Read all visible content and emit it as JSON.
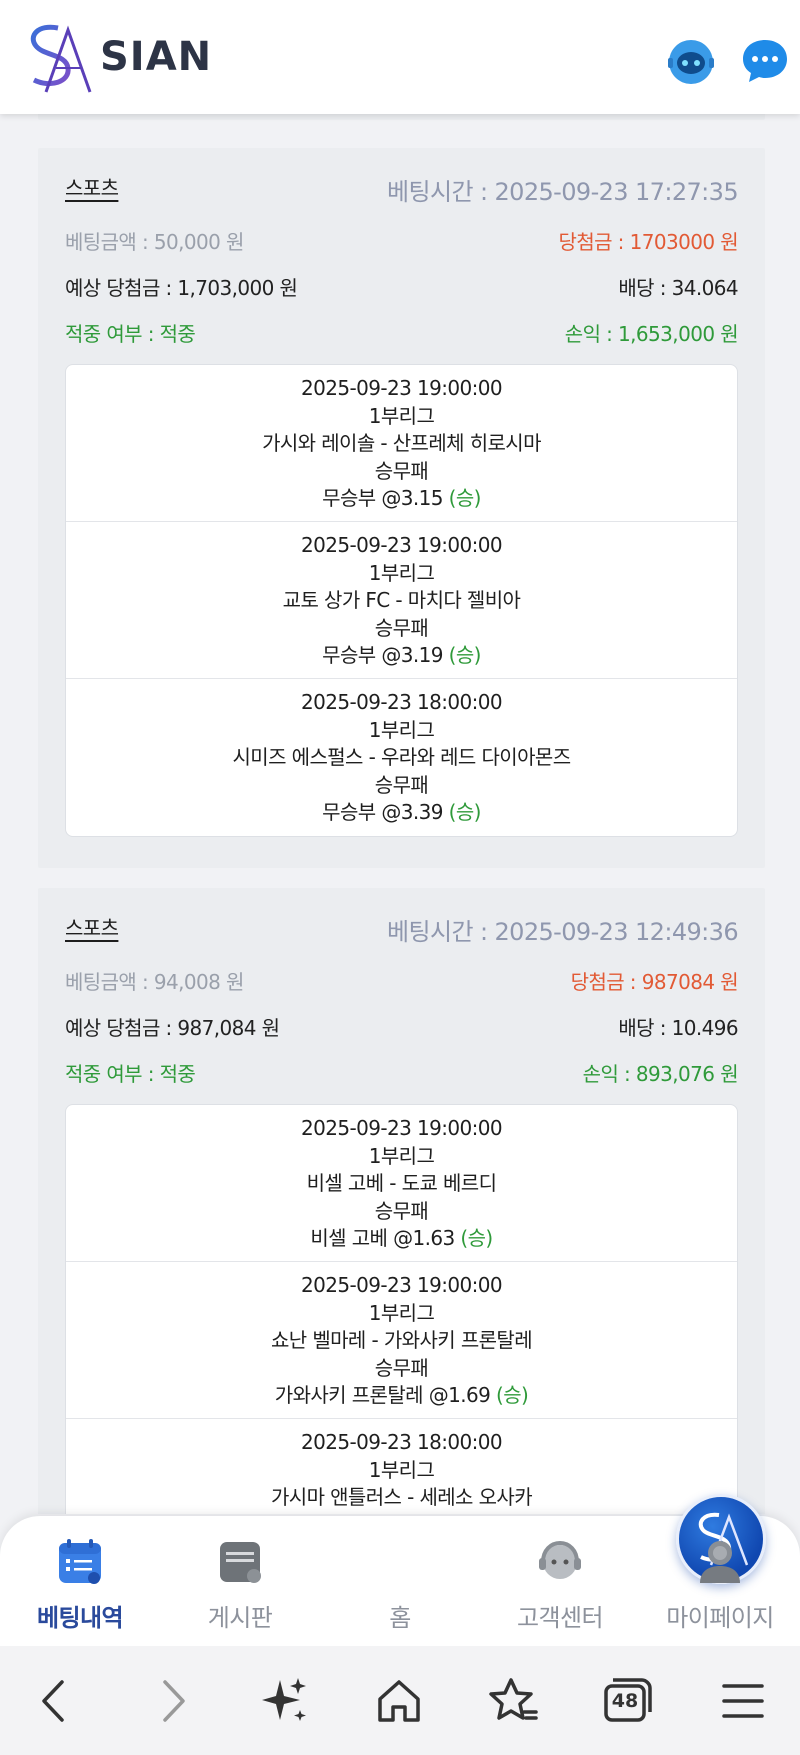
{
  "header": {
    "logo_text": "SIAN",
    "icons": [
      "support-bot-icon",
      "chat-bubble-icon"
    ]
  },
  "bets": [
    {
      "category": "스포츠",
      "bet_time": "베팅시간 : 2025-09-23 17:27:35",
      "bet_amount": "베팅금액 : 50,000 원",
      "win_amount": "당첨금 : 1703000 원",
      "expected": "예상 당첨금 : 1,703,000 원",
      "odds": "배당 : 34.064",
      "hit": "적중 여부 : 적중",
      "profit": "손익 : 1,653,000 원",
      "matches": [
        {
          "datetime": "2025-09-23 19:00:00",
          "league": "1부리그",
          "teams": "가시와 레이솔 - 산프레체 히로시마",
          "market": "승무패",
          "pick": "무승부 @3.15",
          "result": "(승)"
        },
        {
          "datetime": "2025-09-23 19:00:00",
          "league": "1부리그",
          "teams": "교토 상가 FC - 마치다 젤비아",
          "market": "승무패",
          "pick": "무승부 @3.19",
          "result": "(승)"
        },
        {
          "datetime": "2025-09-23 18:00:00",
          "league": "1부리그",
          "teams": "시미즈 에스펄스 - 우라와 레드 다이아몬즈",
          "market": "승무패",
          "pick": "무승부 @3.39",
          "result": "(승)"
        }
      ]
    },
    {
      "category": "스포츠",
      "bet_time": "베팅시간 : 2025-09-23 12:49:36",
      "bet_amount": "베팅금액 : 94,008 원",
      "win_amount": "당첨금 : 987084 원",
      "expected": "예상 당첨금 : 987,084 원",
      "odds": "배당 : 10.496",
      "hit": "적중 여부 : 적중",
      "profit": "손익 : 893,076 원",
      "matches": [
        {
          "datetime": "2025-09-23 19:00:00",
          "league": "1부리그",
          "teams": "비셀 고베 - 도쿄 베르디",
          "market": "승무패",
          "pick": "비셀 고베 @1.63",
          "result": "(승)"
        },
        {
          "datetime": "2025-09-23 19:00:00",
          "league": "1부리그",
          "teams": "쇼난 벨마레 - 가와사키 프론탈레",
          "market": "승무패",
          "pick": "가와사키 프론탈레 @1.69",
          "result": "(승)"
        },
        {
          "datetime": "2025-09-23 18:00:00",
          "league": "1부리그",
          "teams": "가시마 앤틀러스 - 세레소 오사카",
          "market": "",
          "pick": "",
          "result": ""
        }
      ]
    }
  ],
  "bottom_nav": {
    "items": [
      {
        "label": "베팅내역",
        "icon": "calendar-icon",
        "active": true
      },
      {
        "label": "게시판",
        "icon": "board-icon",
        "active": false
      },
      {
        "label": "홈",
        "icon": "home-logo-icon",
        "active": false
      },
      {
        "label": "고객센터",
        "icon": "headset-icon",
        "active": false
      },
      {
        "label": "마이페이지",
        "icon": "user-icon",
        "active": false
      }
    ]
  },
  "browser": {
    "tab_count": "48",
    "icons": [
      "back-icon",
      "forward-icon",
      "sparkle-icon",
      "home-icon",
      "bookmark-star-icon",
      "tabs-icon",
      "menu-icon"
    ]
  },
  "colors": {
    "accent": "#2a4a9c",
    "win_green": "#2f9a3a",
    "win_amount_red": "#e25a35",
    "bet_time_gray": "#8f97ae"
  }
}
